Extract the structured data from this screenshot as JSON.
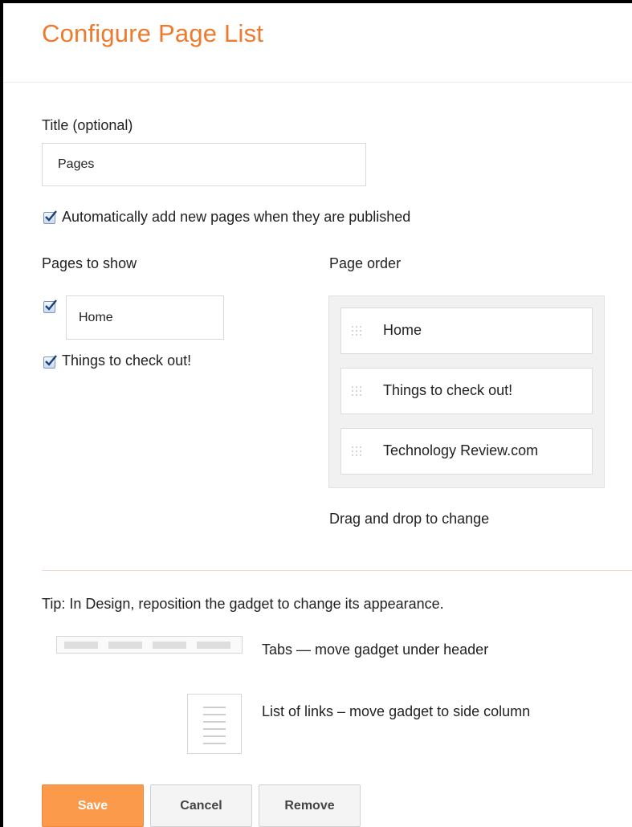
{
  "dialog": {
    "title": "Configure Page List"
  },
  "title_field": {
    "label": "Title (optional)",
    "value": "Pages"
  },
  "auto_add": {
    "checked": true,
    "label": "Automatically add new pages when they are published"
  },
  "pages_to_show": {
    "heading": "Pages to show",
    "items": [
      {
        "checked": true,
        "label": "Home",
        "editable": true
      },
      {
        "checked": true,
        "label": "Things to check out!",
        "editable": false
      }
    ]
  },
  "page_order": {
    "heading": "Page order",
    "items": [
      {
        "label": "Home"
      },
      {
        "label": "Things to check out!"
      },
      {
        "label": "Technology Review.com"
      }
    ],
    "hint": "Drag and drop to change"
  },
  "tip": {
    "text": "Tip: In Design, reposition the gadget to change its appearance.",
    "tabs_text": "Tabs — move gadget under header",
    "links_text": "List of links – move gadget to side column"
  },
  "buttons": {
    "save": "Save",
    "cancel": "Cancel",
    "remove": "Remove"
  },
  "colors": {
    "accent": "#ee7a2d",
    "save_button": "#fb9a4b"
  }
}
